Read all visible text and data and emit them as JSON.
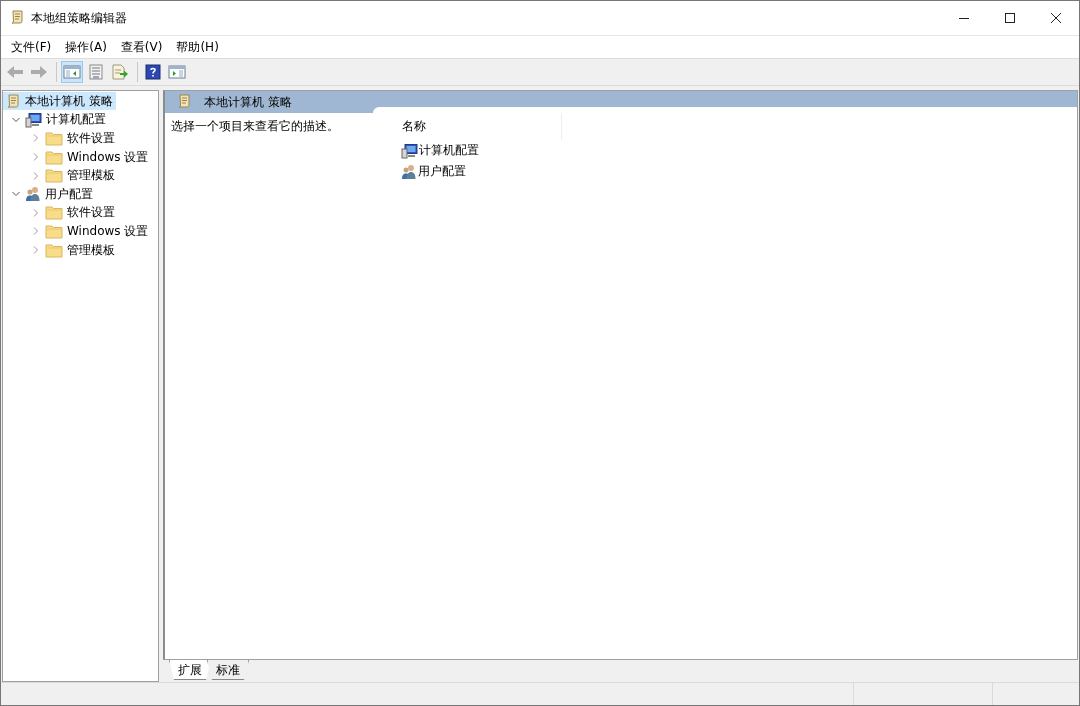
{
  "window": {
    "title": "本地组策略编辑器"
  },
  "menu": [
    "文件(F)",
    "操作(A)",
    "查看(V)",
    "帮助(H)"
  ],
  "toolbar": [
    {
      "kind": "back",
      "disabled": true,
      "pressed": false
    },
    {
      "kind": "forward",
      "disabled": true,
      "pressed": false
    },
    {
      "kind": "tree",
      "disabled": false,
      "pressed": true
    },
    {
      "kind": "properties",
      "disabled": false,
      "pressed": false
    },
    {
      "kind": "export",
      "disabled": false,
      "pressed": false
    },
    {
      "kind": "help",
      "disabled": false,
      "pressed": false
    },
    {
      "kind": "pane",
      "disabled": false,
      "pressed": false
    }
  ],
  "tree": [
    {
      "label": "本地计算机 策略",
      "kind": "scroll",
      "selected": true,
      "children": [
        {
          "label": "计算机配置",
          "kind": "computer",
          "selected": false,
          "expanded": true,
          "children": [
            {
              "label": "软件设置",
              "kind": "folder",
              "selected": false,
              "expanded": false
            },
            {
              "label": "Windows 设置",
              "kind": "folder",
              "selected": false,
              "expanded": false
            },
            {
              "label": "管理模板",
              "kind": "folder",
              "selected": false,
              "expanded": false
            }
          ]
        },
        {
          "label": "用户配置",
          "kind": "users",
          "selected": false,
          "expanded": true,
          "children": [
            {
              "label": "软件设置",
              "kind": "folder",
              "selected": false,
              "expanded": false
            },
            {
              "label": "Windows 设置",
              "kind": "folder",
              "selected": false,
              "expanded": false
            },
            {
              "label": "管理模板",
              "kind": "folder",
              "selected": false,
              "expanded": false
            }
          ]
        }
      ]
    }
  ],
  "details": {
    "header": "本地计算机 策略",
    "description": "选择一个项目来查看它的描述。",
    "column": "名称",
    "items": [
      {
        "label": "计算机配置",
        "kind": "computer"
      },
      {
        "label": "用户配置",
        "kind": "users"
      }
    ]
  },
  "tabs": [
    {
      "label": "扩展",
      "selected": true
    },
    {
      "label": "标准",
      "selected": false
    }
  ]
}
